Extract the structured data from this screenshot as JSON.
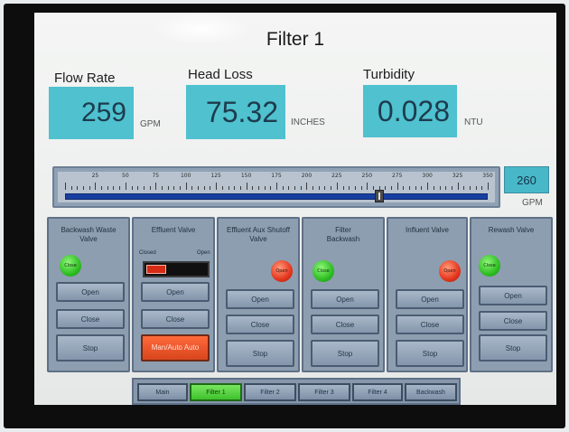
{
  "title": "Filter 1",
  "metrics": [
    {
      "label": "Flow Rate",
      "value": "259",
      "unit": "GPM"
    },
    {
      "label": "Head Loss",
      "value": "75.32",
      "unit": "INCHES"
    },
    {
      "label": "Turbidity",
      "value": "0.028",
      "unit": "NTU"
    }
  ],
  "slider": {
    "tick_labels": [
      "25",
      "50",
      "75",
      "100",
      "125",
      "150",
      "175",
      "200",
      "225",
      "250",
      "275",
      "300",
      "325",
      "350"
    ],
    "value": 260,
    "value_text": "260",
    "min": 25,
    "max": 350,
    "unit": "GPM"
  },
  "valves": [
    {
      "title": "Backwash Waste Valve",
      "status": "Close",
      "status_color": "#2fbf22",
      "buttons": [
        "Open",
        "Close",
        "Stop"
      ]
    },
    {
      "title": "Effluent Valve",
      "closed_label": "Closed",
      "open_label": "Open",
      "position_fraction": 0.32,
      "buttons": [
        "Open",
        "Close",
        "Man/Auto Auto"
      ]
    },
    {
      "title": "Effluent Aux Shutoff Valve",
      "status": "Open",
      "status_color": "#e5361d",
      "buttons": [
        "Open",
        "Close",
        "Stop"
      ]
    },
    {
      "title": "Filter Backwash",
      "status": "Close",
      "status_color": "#2fbf22",
      "buttons": [
        "Open",
        "Close",
        "Stop"
      ]
    },
    {
      "title": "Influent Valve",
      "status": "Open",
      "status_color": "#e5361d",
      "buttons": [
        "Open",
        "Close",
        "Stop"
      ]
    },
    {
      "title": "Rewash Valve",
      "status": "Close",
      "status_color": "#2fbf22",
      "buttons": [
        "Open",
        "Close",
        "Stop"
      ]
    }
  ],
  "nav": {
    "tabs": [
      "Main",
      "Filter 1",
      "Filter 2",
      "Filter 3",
      "Filter 4",
      "Backwash"
    ],
    "active": "Filter 1"
  },
  "colors": {
    "accent": "#4fc1cf",
    "panel": "#8d9eb1",
    "active_tab": "#3fc12d",
    "alarm": "#e5361d"
  }
}
